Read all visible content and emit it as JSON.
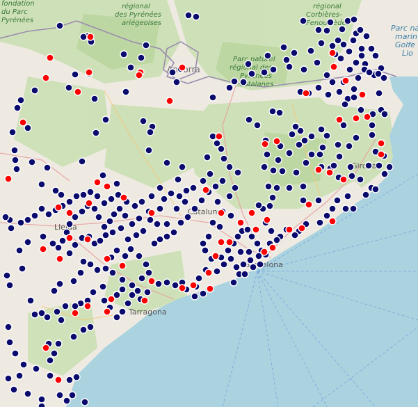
{
  "map": {
    "labels": {
      "top_left": "fondation\ndu Parc\nPyrénées",
      "pyrenees_park": "régional\ndes Pyrénées\nariégeoises",
      "andorra": "Andorra",
      "catalan_park": "Parc naturel\nrégional des\nPyrénées\ncatalanes",
      "corbieres": "régional\nCorbières-\nFenouillèdes",
      "marine_park": "Parc nat\nmarin\nGolfe\nLio",
      "catalunya": "Catalunya",
      "lleida": "Lleida",
      "barcelona": "Barcelona",
      "tarragona": "Tarragona",
      "girona": "Girona"
    },
    "marker_colors": {
      "navy": "#0b0b6e",
      "red": "#ff0000"
    },
    "markers_note": ""
  }
}
